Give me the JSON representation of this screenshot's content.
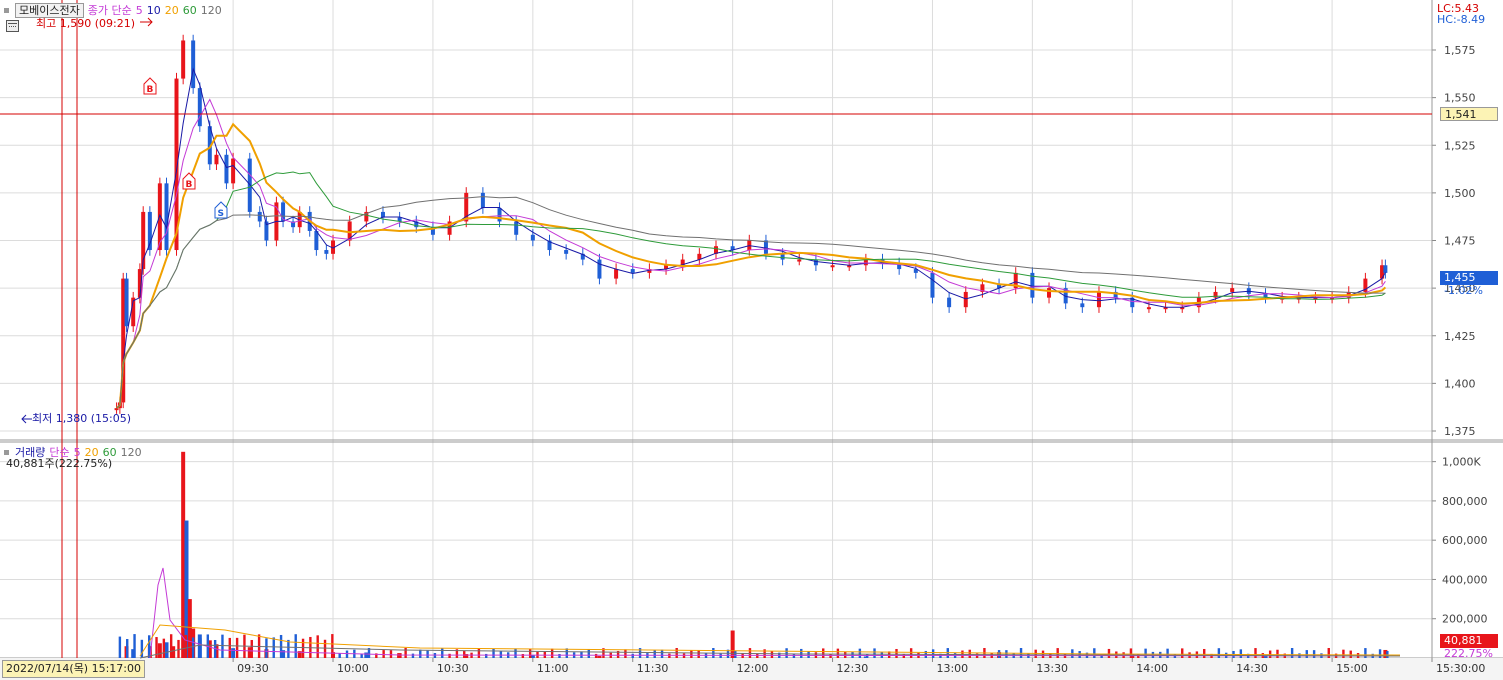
{
  "price_panel": {
    "stock_name": "모베이스전자",
    "ma_title": "종가 단순",
    "ma_periods": [
      "5",
      "10",
      "20",
      "60",
      "120"
    ],
    "high_label": "최고 1,590 (09:21)",
    "low_label": "최저 1,380 (15:05)",
    "lc_label": "LC:5.43",
    "hc_label": "HC:-8.49",
    "crosshair_price": "1,541",
    "current_price": "1,455",
    "current_change": "-1.02%",
    "marker_labels": [
      "B",
      "B",
      "S"
    ]
  },
  "volume_panel": {
    "title": "거래량",
    "ma_title": "단순",
    "ma_periods": [
      "5",
      "20",
      "60",
      "120"
    ],
    "value_label": "40,881주(222.75%)",
    "current_volume": "40,881",
    "current_pct": "222.75%"
  },
  "footer": {
    "datetime": "2022/07/14(목) 15:17:00"
  },
  "colors": {
    "up": "#e8151b",
    "down": "#1f5fd6",
    "ma5": "#1a1aa6",
    "ma10": "#c43ad6",
    "ma20": "#f0a000",
    "ma60": "#2e9b3a",
    "ma120": "#707070",
    "crosshair": "#d40000",
    "grid": "#dcdcdc"
  },
  "chart_data": [
    {
      "type": "line",
      "title": "모베이스전자",
      "x_ticks": [
        "09:30",
        "10:00",
        "10:30",
        "11:00",
        "11:30",
        "12:00",
        "12:30",
        "13:00",
        "13:30",
        "14:00",
        "14:30",
        "15:00",
        "15:30:00"
      ],
      "y_ticks": [
        1375,
        1400,
        1425,
        1450,
        1475,
        1500,
        1525,
        1550,
        1575
      ],
      "ylim": [
        1370,
        1600
      ],
      "time_range_minutes": [
        500,
        930
      ],
      "series": [
        {
          "name": "종가",
          "x": [
            535,
            536,
            537,
            538,
            540,
            542,
            543,
            545,
            548,
            550,
            553,
            555,
            558,
            560,
            563,
            565,
            568,
            570,
            575,
            578,
            580,
            583,
            585,
            588,
            590,
            593,
            595,
            598,
            600,
            605,
            610,
            615,
            620,
            625,
            630,
            635,
            640,
            645,
            650,
            655,
            660,
            665,
            670,
            675,
            680,
            685,
            690,
            695,
            700,
            705,
            710,
            715,
            720,
            725,
            730,
            735,
            740,
            745,
            750,
            755,
            760,
            765,
            770,
            775,
            780,
            785,
            790,
            795,
            800,
            805,
            810,
            815,
            820,
            825,
            830,
            835,
            840,
            845,
            850,
            855,
            860,
            865,
            870,
            875,
            880,
            885,
            890,
            895,
            900,
            905,
            910,
            915,
            916
          ],
          "values": [
            1387,
            1390,
            1455,
            1430,
            1445,
            1460,
            1490,
            1470,
            1505,
            1470,
            1560,
            1580,
            1555,
            1535,
            1515,
            1520,
            1505,
            1518,
            1490,
            1485,
            1475,
            1495,
            1485,
            1482,
            1490,
            1480,
            1470,
            1468,
            1475,
            1485,
            1490,
            1487,
            1485,
            1482,
            1478,
            1485,
            1500,
            1492,
            1485,
            1478,
            1475,
            1470,
            1468,
            1465,
            1455,
            1460,
            1458,
            1460,
            1462,
            1465,
            1468,
            1472,
            1470,
            1475,
            1468,
            1465,
            1465,
            1462,
            1462,
            1462,
            1465,
            1463,
            1460,
            1458,
            1445,
            1440,
            1448,
            1452,
            1450,
            1458,
            1445,
            1450,
            1442,
            1440,
            1448,
            1445,
            1440,
            1440,
            1440,
            1440,
            1445,
            1448,
            1450,
            1447,
            1445,
            1445,
            1445,
            1445,
            1445,
            1448,
            1455,
            1462,
            1458
          ]
        }
      ]
    },
    {
      "type": "bar",
      "title": "거래량",
      "y_ticks": [
        200000,
        400000,
        600000,
        800000,
        1000000
      ],
      "y_tick_labels": [
        "200,000",
        "400,000",
        "600,000",
        "800,000",
        "1,000K"
      ],
      "ylim": [
        0,
        1100000
      ],
      "series": [
        {
          "name": "거래량",
          "x": [
            538,
            540,
            545,
            548,
            550,
            552,
            555,
            556,
            557,
            558,
            560,
            563,
            565,
            570,
            575,
            580,
            585,
            590,
            600,
            610,
            620,
            640,
            660,
            680,
            720,
            760,
            800,
            840,
            880,
            916
          ],
          "values": [
            60000,
            45000,
            60000,
            75000,
            80000,
            60000,
            1050000,
            700000,
            300000,
            150000,
            120000,
            90000,
            70000,
            50000,
            55000,
            45000,
            40000,
            35000,
            30000,
            28000,
            25000,
            20000,
            15000,
            10000,
            140000,
            8000,
            30000,
            20000,
            12000,
            40881
          ]
        }
      ]
    }
  ]
}
